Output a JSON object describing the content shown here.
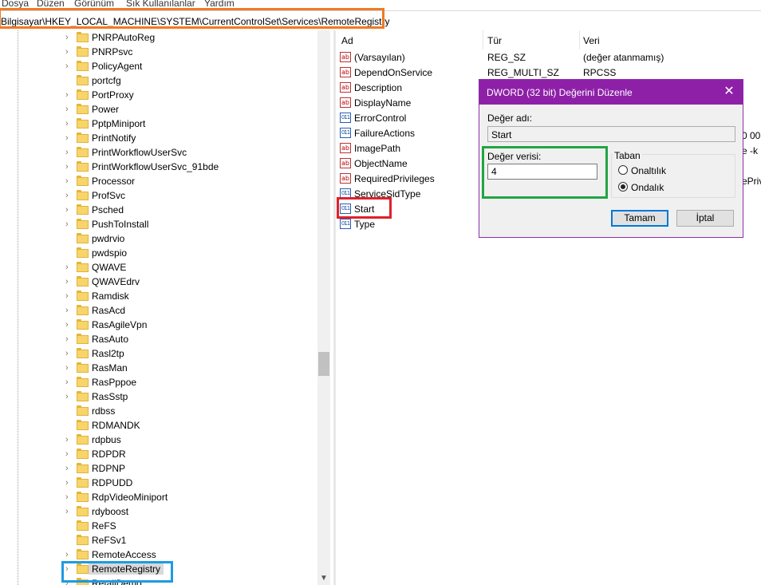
{
  "menu": {
    "items": [
      "Dosya",
      "Düzen",
      "Görünüm",
      "Sık Kullanılanlar",
      "Yardım"
    ]
  },
  "address": {
    "path": "Bilgisayar\\HKEY_LOCAL_MACHINE\\SYSTEM\\CurrentControlSet\\Services\\RemoteRegistry"
  },
  "tree": {
    "items": [
      {
        "label": "PNRPAutoReg",
        "expandable": true
      },
      {
        "label": "PNRPsvc",
        "expandable": true
      },
      {
        "label": "PolicyAgent",
        "expandable": true
      },
      {
        "label": "portcfg",
        "expandable": false
      },
      {
        "label": "PortProxy",
        "expandable": true
      },
      {
        "label": "Power",
        "expandable": true
      },
      {
        "label": "PptpMiniport",
        "expandable": true
      },
      {
        "label": "PrintNotify",
        "expandable": true
      },
      {
        "label": "PrintWorkflowUserSvc",
        "expandable": true
      },
      {
        "label": "PrintWorkflowUserSvc_91bde",
        "expandable": true
      },
      {
        "label": "Processor",
        "expandable": true
      },
      {
        "label": "ProfSvc",
        "expandable": true
      },
      {
        "label": "Psched",
        "expandable": true
      },
      {
        "label": "PushToInstall",
        "expandable": true
      },
      {
        "label": "pwdrvio",
        "expandable": false
      },
      {
        "label": "pwdspio",
        "expandable": false
      },
      {
        "label": "QWAVE",
        "expandable": true
      },
      {
        "label": "QWAVEdrv",
        "expandable": true
      },
      {
        "label": "Ramdisk",
        "expandable": true
      },
      {
        "label": "RasAcd",
        "expandable": true
      },
      {
        "label": "RasAgileVpn",
        "expandable": true
      },
      {
        "label": "RasAuto",
        "expandable": true
      },
      {
        "label": "Rasl2tp",
        "expandable": true
      },
      {
        "label": "RasMan",
        "expandable": true
      },
      {
        "label": "RasPppoe",
        "expandable": true
      },
      {
        "label": "RasSstp",
        "expandable": true
      },
      {
        "label": "rdbss",
        "expandable": false
      },
      {
        "label": "RDMANDK",
        "expandable": false
      },
      {
        "label": "rdpbus",
        "expandable": true
      },
      {
        "label": "RDPDR",
        "expandable": true
      },
      {
        "label": "RDPNP",
        "expandable": true
      },
      {
        "label": "RDPUDD",
        "expandable": true
      },
      {
        "label": "RdpVideoMiniport",
        "expandable": true
      },
      {
        "label": "rdyboost",
        "expandable": true
      },
      {
        "label": "ReFS",
        "expandable": false
      },
      {
        "label": "ReFSv1",
        "expandable": false
      },
      {
        "label": "RemoteAccess",
        "expandable": true
      },
      {
        "label": "RemoteRegistry",
        "expandable": true,
        "selected": true
      },
      {
        "label": "RetailDemo",
        "expandable": true
      }
    ]
  },
  "values_pane": {
    "columns": {
      "name": "Ad",
      "type": "Tür",
      "data": "Veri"
    },
    "rows": [
      {
        "icon": "ab",
        "name": "(Varsayılan)",
        "type": "REG_SZ",
        "data": "(değer atanmamış)"
      },
      {
        "icon": "ab",
        "name": "DependOnService",
        "type": "REG_MULTI_SZ",
        "data": "RPCSS"
      },
      {
        "icon": "ab",
        "name": "Description",
        "type": "",
        "data": ""
      },
      {
        "icon": "ab",
        "name": "DisplayName",
        "type": "",
        "data": ""
      },
      {
        "icon": "bin",
        "name": "ErrorControl",
        "type": "",
        "data": ""
      },
      {
        "icon": "bin",
        "name": "FailureActions",
        "type": "",
        "data": ""
      },
      {
        "icon": "ab",
        "name": "ImagePath",
        "type": "",
        "data": ""
      },
      {
        "icon": "ab",
        "name": "ObjectName",
        "type": "",
        "data": ""
      },
      {
        "icon": "ab",
        "name": "RequiredPrivileges",
        "type": "",
        "data": ""
      },
      {
        "icon": "bin",
        "name": "ServiceSidType",
        "type": "",
        "data": ""
      },
      {
        "icon": "bin",
        "name": "Start",
        "type": "",
        "data": ""
      },
      {
        "icon": "bin",
        "name": "Type",
        "type": "",
        "data": ""
      }
    ],
    "partial_data": [
      "0 00",
      "e -k l",
      "ePriv"
    ]
  },
  "dialog": {
    "title": "DWORD (32 bit) Değerini Düzenle",
    "name_label": "Değer adı:",
    "name_value": "Start",
    "data_label": "Değer verisi:",
    "data_value": "4",
    "base_label": "Taban",
    "base_options": [
      {
        "label": "Onaltılık",
        "selected": false
      },
      {
        "label": "Ondalık",
        "selected": true
      }
    ],
    "ok_label": "Tamam",
    "cancel_label": "İptal"
  },
  "colors": {
    "dialog_title_bg": "#8e20a8",
    "highlight_orange": "#f07a24",
    "highlight_red": "#e0202a",
    "highlight_green": "#22a544",
    "highlight_blue": "#1d9be2"
  }
}
